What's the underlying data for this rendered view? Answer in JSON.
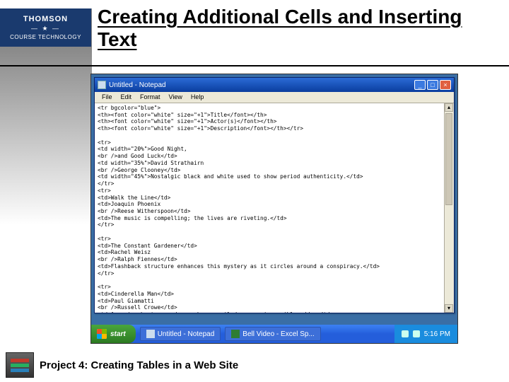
{
  "brand": {
    "top": "THOMSON",
    "star": "— ★ —",
    "bottom": "COURSE TECHNOLOGY"
  },
  "title": "Creating Additional Cells and Inserting Text",
  "notepad": {
    "title": "Untitled - Notepad",
    "menu": {
      "file": "File",
      "edit": "Edit",
      "format": "Format",
      "view": "View",
      "help": "Help"
    },
    "buttons": {
      "min": "_",
      "max": "□",
      "close": "×"
    },
    "scroll": {
      "up": "▴",
      "down": "▾"
    },
    "content": "<tr bgcolor=\"blue\">\n<th><font color=\"white\" size=\"+1\">Title</font></th>\n<th><font color=\"white\" size=\"+1\">Actor(s)</font></th>\n<th><font color=\"white\" size=\"+1\">Description</font></th></tr>\n\n<tr>\n<td width=\"20%\">Good Night,\n<br />and Good Luck</td>\n<td width=\"35%\">David Strathairn\n<br />George Clooney</td>\n<td width=\"45%\">Nostalgic black and white used to show period authenticity.</td>\n</tr>\n<tr>\n<td>Walk the Line</td>\n<td>Joaquin Phoenix\n<br />Reese Witherspoon</td>\n<td>The music is compelling; the lives are riveting.</td>\n</tr>\n\n<tr>\n<td>The Constant Gardener</td>\n<td>Rachel Weisz\n<br />Ralph Fiennes</td>\n<td>Flashback structure enhances this mystery as it circles around a conspiracy.</td>\n</tr>\n\n<tr>\n<td>Cinderella Man</td>\n<td>Paul Giamatti\n<br />Russell Crowe</td>\n<td>A movie about a good man who prevailed across impossible odds.</td>\n</tr>\n</table>\n\n</body>\n</html>"
  },
  "taskbar": {
    "start": "start",
    "task1": "Untitled - Notepad",
    "task2": "Bell Video - Excel Sp...",
    "clock": "5:16 PM"
  },
  "footer": "Project 4: Creating Tables in a Web Site"
}
